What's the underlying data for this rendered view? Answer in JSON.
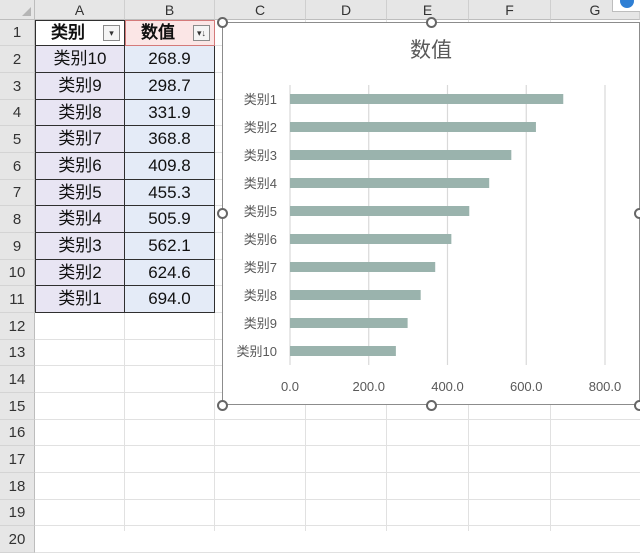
{
  "spreadsheet": {
    "columns": [
      "A",
      "B",
      "C",
      "D",
      "E",
      "F",
      "G"
    ],
    "rows": [
      "1",
      "2",
      "3",
      "4",
      "5",
      "6",
      "7",
      "8",
      "9",
      "10",
      "11",
      "12",
      "13",
      "14",
      "15",
      "16",
      "17",
      "18",
      "19",
      "20"
    ],
    "table": {
      "headers": [
        "类别",
        "数值"
      ],
      "rows": [
        [
          "类别10",
          "268.9"
        ],
        [
          "类别9",
          "298.7"
        ],
        [
          "类别8",
          "331.9"
        ],
        [
          "类别7",
          "368.8"
        ],
        [
          "类别6",
          "409.8"
        ],
        [
          "类别5",
          "455.3"
        ],
        [
          "类别4",
          "505.9"
        ],
        [
          "类别3",
          "562.1"
        ],
        [
          "类别2",
          "624.6"
        ],
        [
          "类别1",
          "694.0"
        ]
      ]
    },
    "filter_icon": "filter-dropdown-icon",
    "sort_filter_icon": "sort-descending-filter-icon"
  },
  "chart_data": {
    "type": "bar",
    "orientation": "horizontal",
    "title": "数值",
    "categories": [
      "类别1",
      "类别2",
      "类别3",
      "类别4",
      "类别5",
      "类别6",
      "类别7",
      "类别8",
      "类别9",
      "类别10"
    ],
    "values": [
      694.0,
      624.6,
      562.1,
      505.9,
      455.3,
      409.8,
      368.8,
      331.9,
      298.7,
      268.9
    ],
    "xlim": [
      0,
      800
    ],
    "xticks": [
      "0.0",
      "200.0",
      "400.0",
      "600.0",
      "800.0"
    ],
    "grid": "vertical",
    "legend": "none",
    "bar_color": "#9ab3ad"
  },
  "colors": {
    "header_bg": "#e6e6e6",
    "colA_bg": "#e8e5f3",
    "colB_bg": "#e4ebf7",
    "colB_header_bg": "#fbe6e6",
    "bar": "#9ab3ad"
  }
}
